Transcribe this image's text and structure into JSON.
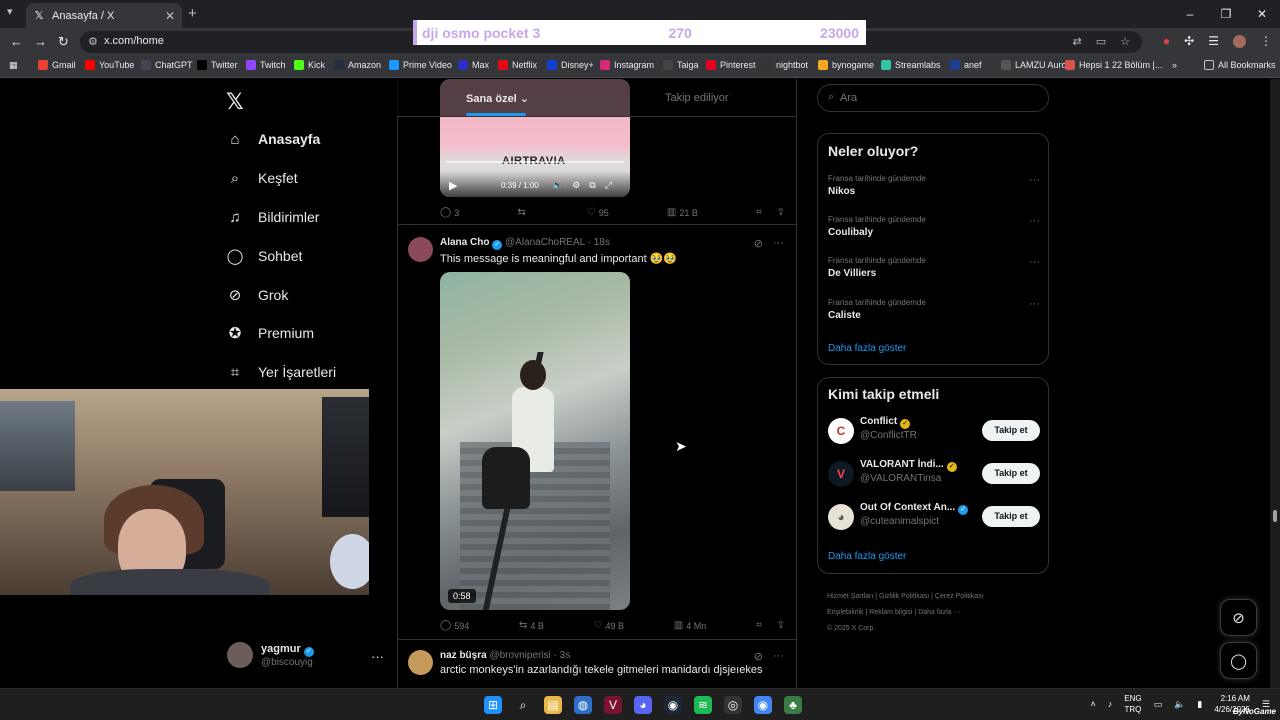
{
  "browser": {
    "tab_title": "Anasayfa / X",
    "new_tab": "+",
    "url": "x.com/home",
    "bookmarks": [
      {
        "label": "Gmail",
        "icon": "gmail-icon",
        "color": "#ea4335"
      },
      {
        "label": "YouTube",
        "icon": "youtube-icon",
        "color": "#ff0000"
      },
      {
        "label": "ChatGPT",
        "icon": "chatgpt-icon",
        "color": "#444654"
      },
      {
        "label": "Twitter",
        "icon": "x-icon",
        "color": "#000000"
      },
      {
        "label": "Twitch",
        "icon": "twitch-icon",
        "color": "#9146ff"
      },
      {
        "label": "Kick",
        "icon": "kick-icon",
        "color": "#53fc18"
      },
      {
        "label": "Amazon",
        "icon": "amazon-icon",
        "color": "#232f3e"
      },
      {
        "label": "Prime Video",
        "icon": "prime-video-icon",
        "color": "#1a98ff"
      },
      {
        "label": "Max",
        "icon": "max-icon",
        "color": "#2f2fbf"
      },
      {
        "label": "Netflix",
        "icon": "netflix-icon",
        "color": "#e50914"
      },
      {
        "label": "Disney+",
        "icon": "disney-icon",
        "color": "#113ccf"
      },
      {
        "label": "Instagram",
        "icon": "instagram-icon",
        "color": "#d62976"
      },
      {
        "label": "Taiga",
        "icon": "taiga-icon",
        "color": "#444444"
      },
      {
        "label": "Pinterest",
        "icon": "pinterest-icon",
        "color": "#e60023"
      },
      {
        "label": "nightbot",
        "icon": "nightbot-icon",
        "color": "#333333"
      },
      {
        "label": "bynogame",
        "icon": "bynogame-icon",
        "color": "#f5a623"
      },
      {
        "label": "Streamlabs",
        "icon": "streamlabs-icon",
        "color": "#31c3a2"
      },
      {
        "label": "anef",
        "icon": "anef-icon",
        "color": "#1d3f8f"
      },
      {
        "label": "LAMZU Aurora",
        "icon": "lamzu-icon",
        "color": "#555555"
      },
      {
        "label": "Hepsi 1 22 Bölüm |...",
        "icon": "hepsi-icon",
        "color": "#d9534f"
      }
    ],
    "more_bookmarks": "»",
    "all_bookmarks": "All Bookmarks"
  },
  "stream_overlay": {
    "item": "dji osmo pocket 3",
    "current": "270",
    "goal": "23000"
  },
  "sidebar": {
    "items": [
      {
        "label": "Anasayfa",
        "icon": "home-icon",
        "glyph": "⌂"
      },
      {
        "label": "Keşfet",
        "icon": "search-icon",
        "glyph": "⌕"
      },
      {
        "label": "Bildirimler",
        "icon": "bell-icon",
        "glyph": "♫"
      },
      {
        "label": "Sohbet",
        "icon": "chat-icon",
        "glyph": "◯"
      },
      {
        "label": "Grok",
        "icon": "grok-icon",
        "glyph": "⊘"
      },
      {
        "label": "Premium",
        "icon": "premium-icon",
        "glyph": "✪"
      },
      {
        "label": "Yer İşaretleri",
        "icon": "bookmark-icon",
        "glyph": "⌗"
      }
    ],
    "profile": {
      "name": "yagmur",
      "handle": "@biscouyig",
      "more": "···"
    }
  },
  "feed": {
    "tabs": {
      "active": "Sana özel",
      "inactive": "Takip ediliyor"
    },
    "post1": {
      "brand_text": "AIRTRAVIA",
      "time": "0:39 / 1:00",
      "replies": "3",
      "reposts": "",
      "likes": "95",
      "views": "21 B"
    },
    "post2": {
      "name": "Alana Cho",
      "handle": "@AlanaChoREAL",
      "time": "· 18s",
      "text": "This message is meaningful and important 🥹🥹",
      "duration": "0:58",
      "replies": "594",
      "reposts": "4 B",
      "likes": "49 B",
      "views": "4 Mn"
    },
    "post3": {
      "name": "naz büşra",
      "handle": "@brovniperisi",
      "time": "· 3s",
      "text": "arctic monkeys'in azarlandığı tekele gitmeleri manidardı djsjeıekes"
    }
  },
  "right": {
    "search_placeholder": "Ara",
    "trends_title": "Neler oluyor?",
    "trends": [
      {
        "meta": "Fransa tarihinde gündemde",
        "name": "Nikos"
      },
      {
        "meta": "Fransa tarihinde gündemde",
        "name": "Coulibaly"
      },
      {
        "meta": "Fransa tarihinde gündemde",
        "name": "De Villiers"
      },
      {
        "meta": "Fransa tarihinde gündemde",
        "name": "Caliste"
      }
    ],
    "trends_more": "Daha fazla göster",
    "follow_title": "Kimi takip etmeli",
    "follow": [
      {
        "name": "Conflict",
        "handle": "@ConflictTR",
        "button": "Takip et",
        "initial": "C",
        "bg": "#ffffff",
        "fg": "#c0392b"
      },
      {
        "name": "VALORANT İndi...",
        "handle": "@VALORANTinsa",
        "button": "Takip et",
        "initial": "V",
        "bg": "#0f1923",
        "fg": "#ff4655"
      },
      {
        "name": "Out Of Context An...",
        "handle": "@cuteanimalspict",
        "button": "Takip et",
        "initial": "◕",
        "bg": "#e8e2d6",
        "fg": "#555555"
      }
    ],
    "follow_more": "Daha fazla göster",
    "footer": [
      "Hizmet Şartları",
      "Gizlilik Politikası",
      "Çerez Politikası",
      "Erişilebilirlik",
      "Reklam bilgisi",
      "Daha fazla ···",
      "© 2025 X Corp."
    ]
  },
  "taskbar": {
    "lang": "ENG",
    "lang2": "TRQ",
    "time": "2:16 AM",
    "date": "4/26/2025",
    "watermark": "ByNoGame"
  },
  "colors": {
    "accent": "#1d9bf0",
    "overlay_text": "#c9a6ea"
  }
}
